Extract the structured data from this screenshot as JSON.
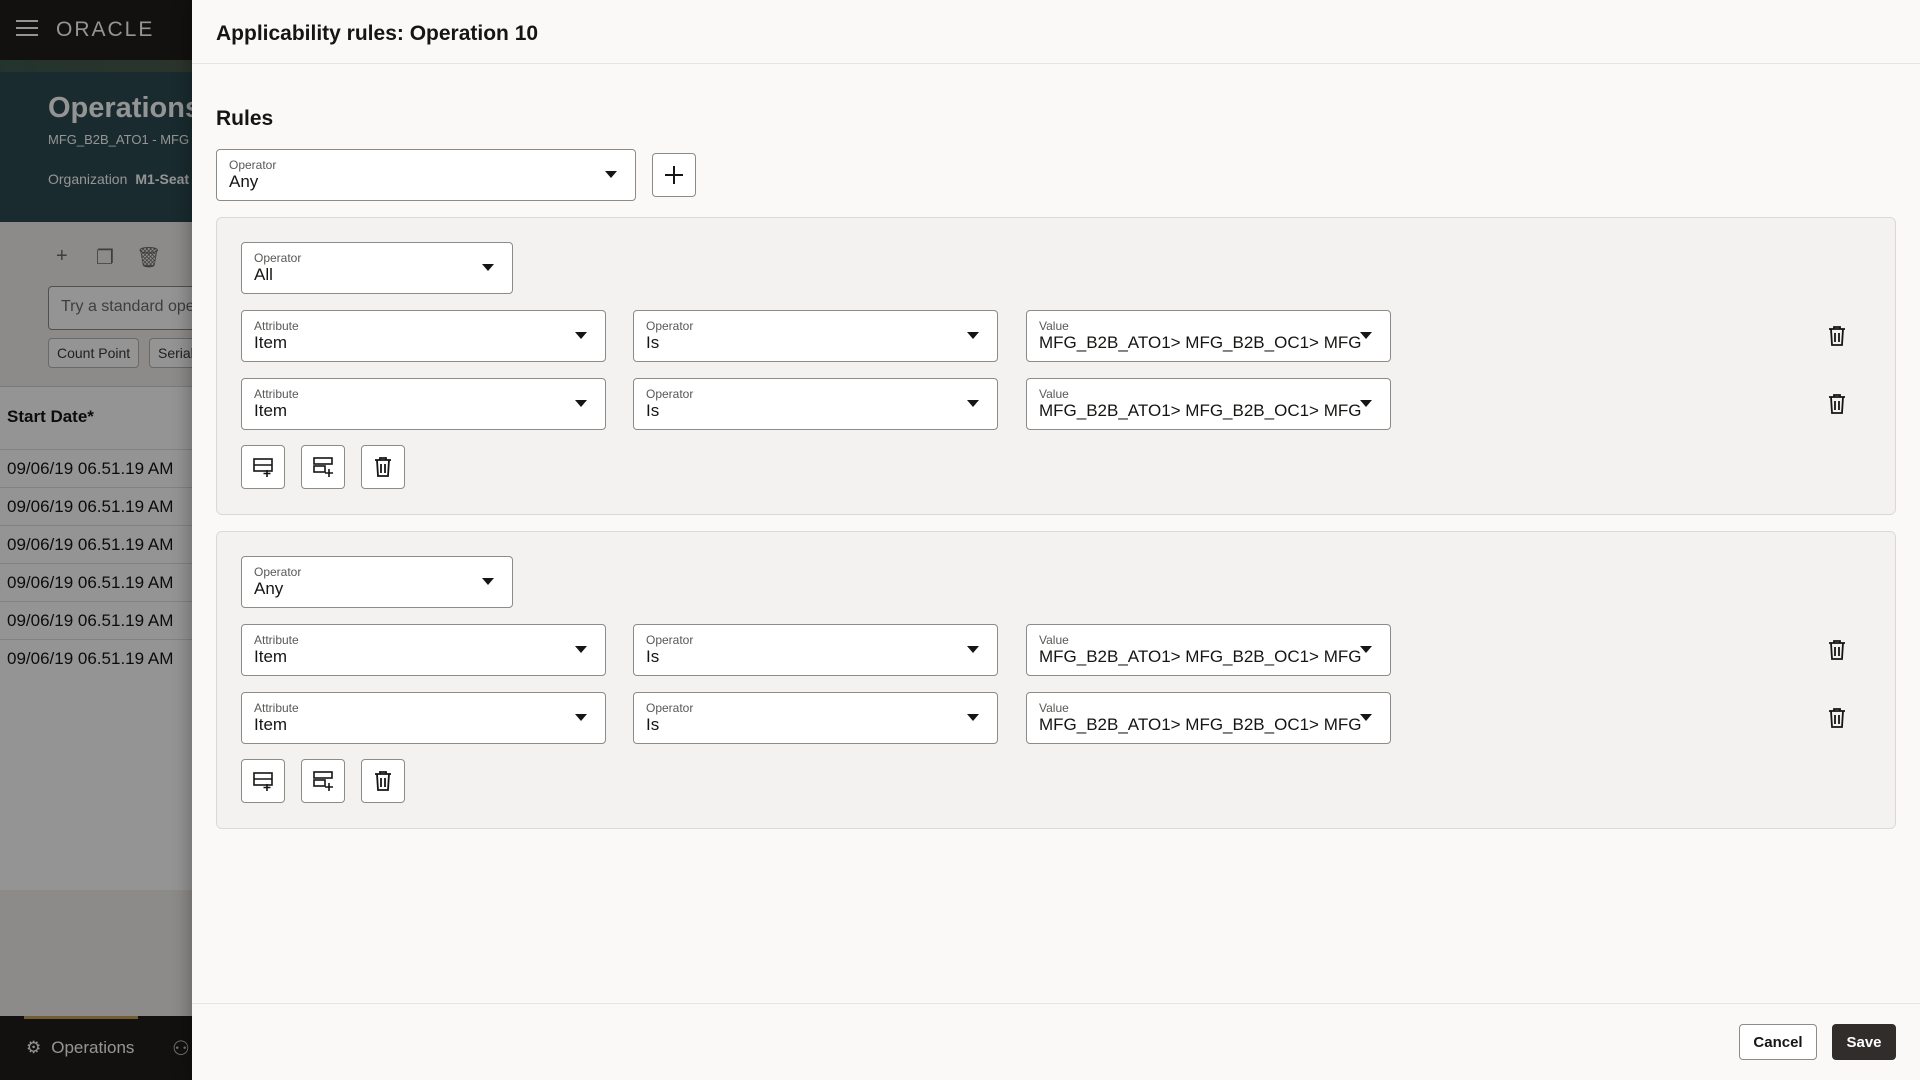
{
  "background": {
    "logo": "ORACLE",
    "title": "Operations",
    "subtitle": "MFG_B2B_ATO1 - MFG",
    "org_label": "Organization",
    "org_value": "M1-Seat",
    "search_placeholder": "Try a standard ope",
    "chip_count_point": "Count Point",
    "chip_serial": "Serial",
    "table_header": "Start Date*",
    "rows": [
      "09/06/19 06.51.19 AM",
      "09/06/19 06.51.19 AM",
      "09/06/19 06.51.19 AM",
      "09/06/19 06.51.19 AM",
      "09/06/19 06.51.19 AM",
      "09/06/19 06.51.19 AM"
    ],
    "bottom_nav_label": "Operations"
  },
  "drawer": {
    "title": "Applicability rules: Operation 10",
    "section_title": "Rules",
    "top_operator": {
      "label": "Operator",
      "value": "Any"
    },
    "groups": [
      {
        "operator": {
          "label": "Operator",
          "value": "All"
        },
        "rows": [
          {
            "attribute_label": "Attribute",
            "attribute_value": "Item",
            "operator_label": "Operator",
            "operator_value": "Is",
            "value_label": "Value",
            "value_value": "MFG_B2B_ATO1> MFG_B2B_OC1> MFG"
          },
          {
            "attribute_label": "Attribute",
            "attribute_value": "Item",
            "operator_label": "Operator",
            "operator_value": "Is",
            "value_label": "Value",
            "value_value": "MFG_B2B_ATO1> MFG_B2B_OC1> MFG"
          }
        ]
      },
      {
        "operator": {
          "label": "Operator",
          "value": "Any"
        },
        "rows": [
          {
            "attribute_label": "Attribute",
            "attribute_value": "Item",
            "operator_label": "Operator",
            "operator_value": "Is",
            "value_label": "Value",
            "value_value": "MFG_B2B_ATO1> MFG_B2B_OC1> MFG"
          },
          {
            "attribute_label": "Attribute",
            "attribute_value": "Item",
            "operator_label": "Operator",
            "operator_value": "Is",
            "value_label": "Value",
            "value_value": "MFG_B2B_ATO1> MFG_B2B_OC1> MFG"
          }
        ]
      }
    ],
    "footer": {
      "cancel_label": "Cancel",
      "save_label": "Save"
    }
  }
}
